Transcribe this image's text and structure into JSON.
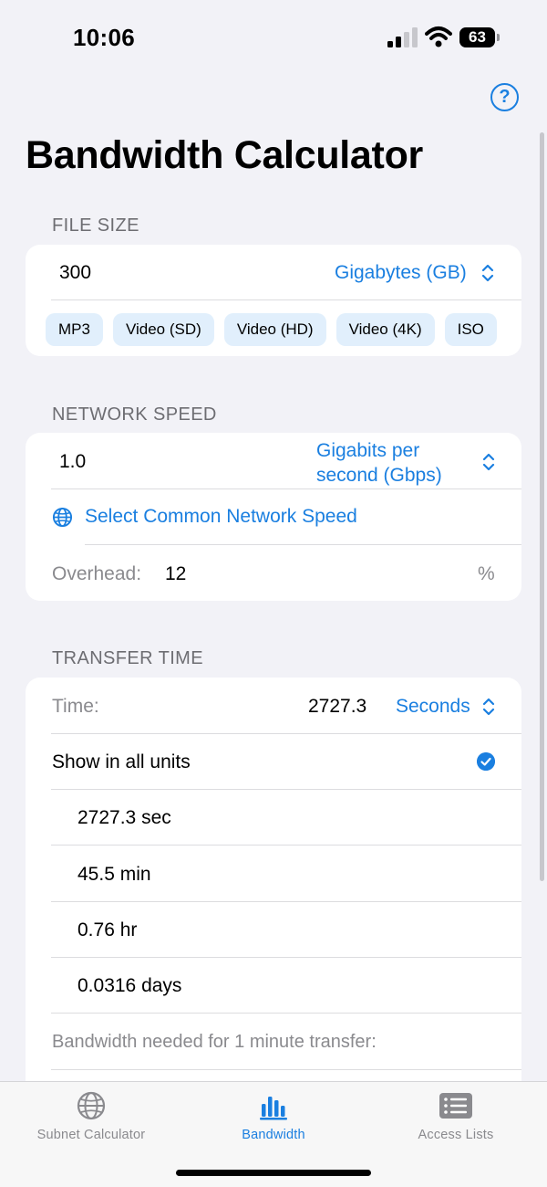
{
  "status": {
    "time": "10:06",
    "battery": "63"
  },
  "header": {
    "title": "Bandwidth Calculator"
  },
  "file_size": {
    "section": "FILE SIZE",
    "value": "300",
    "unit": "Gigabytes (GB)",
    "presets": [
      "MP3",
      "Video (SD)",
      "Video (HD)",
      "Video (4K)",
      "ISO"
    ]
  },
  "network": {
    "section": "NETWORK SPEED",
    "value": "1.0",
    "unit_line1": "Gigabits per",
    "unit_line2": "second (Gbps)",
    "common_label": "Select Common Network Speed",
    "overhead_label": "Overhead:",
    "overhead_value": "12",
    "overhead_unit": "%"
  },
  "transfer": {
    "section": "TRANSFER TIME",
    "time_label": "Time:",
    "time_value": "2727.3",
    "time_unit": "Seconds",
    "show_all_label": "Show in all units",
    "units": [
      "2727.3 sec",
      "45.5 min",
      "0.76 hr",
      "0.0316 days"
    ],
    "bandwidth_needed_label": "Bandwidth needed for 1 minute transfer:"
  },
  "tabs": [
    {
      "label": "Subnet Calculator",
      "icon": "globe-icon"
    },
    {
      "label": "Bandwidth",
      "icon": "chart-bar-icon"
    },
    {
      "label": "Access Lists",
      "icon": "list-icon"
    }
  ],
  "colors": {
    "accent": "#1a7fe0",
    "background": "#f2f2f7",
    "chip": "#e1effc"
  }
}
